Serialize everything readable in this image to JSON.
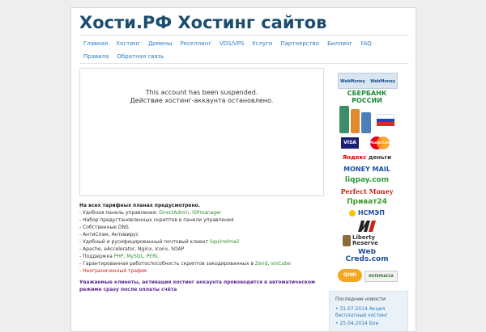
{
  "site": {
    "title": "Хости.РФ Хостинг сайтов"
  },
  "nav": [
    "Главная",
    "Хостинг",
    "Домены",
    "Реселлинг",
    "VDS/VPS",
    "Услуги",
    "Партнерство",
    "Биллинг",
    "FAQ",
    "Правила",
    "Обратная связь"
  ],
  "suspended": {
    "line_en": "This account has been suspended.",
    "line_ru": "Действие хостинг-аккаунта остановлено."
  },
  "features": {
    "heading": "На всех тарифных планах предусмотрено.",
    "panel_prefix": "- Удобная панель управления: ",
    "panel_da": "DirectAdmin",
    "panel_sep": ", ",
    "panel_isp": "ISPmanager",
    "scripts": "- Набор предустановленных скриптов в панели управления",
    "dns": "- Собственные DNS",
    "antispam": "- АнтиСпам, Антивирус",
    "mail_prefix": "- Удобный и русифицированный почтовый клиент ",
    "mail_link": "Squirrelmail",
    "apache": "- Apache, eAccelerator, Nginx, Iconv, SOAP",
    "support_prefix": "- Поддержка ",
    "lang_php": "PHP",
    "lang_sep1": ", ",
    "lang_mysql": "MySQL",
    "lang_sep2": ", ",
    "lang_perl": "PERL",
    "encoded_prefix": "- Гарантированная работоспособность скриптов закодированных в ",
    "zend": "Zend",
    "enc_sep": ", ",
    "ioncube": "ionCube",
    "traffic": "- Неограниченный трафик"
  },
  "notice": "Уважаемые клиенты, активация хостинг аккаунта производится в автоматическом режиме сразу после оплаты счёта",
  "payments": {
    "webmoney_top_left": "WebMoney",
    "webmoney_top_right": "WebMoney",
    "sberbank_1": "СБЕРБАНК",
    "sberbank_2": "РОССИИ",
    "visa": "VISA",
    "mastercard": "MasterCard",
    "yandex": "Яндекс",
    "dengi": "деньги",
    "moneymail": "MONEY MAIL",
    "liqpay": "liqpay.com",
    "perfect_money": "Perfect Money",
    "privat24": "Приват24",
    "nsmep": "НСМЭП",
    "liberty_1": "Liberty",
    "liberty_2": "Reserve",
    "webcreds_1": "Web",
    "webcreds_2": "Creds.com",
    "qiwi": "QIWI",
    "interkassa": "ИНТЕРКАССА"
  },
  "news": {
    "title": "Последние новости",
    "items": [
      "31.07.2014 Акция бесплатный хостинг",
      "25.04.2014 Бон"
    ]
  },
  "colors": {
    "title": "#1a4d6e",
    "link": "#2b7dbc",
    "accent_green": "#2f8f2f",
    "traffic_red": "#d62020",
    "notice_purple": "#5d2a8f"
  }
}
